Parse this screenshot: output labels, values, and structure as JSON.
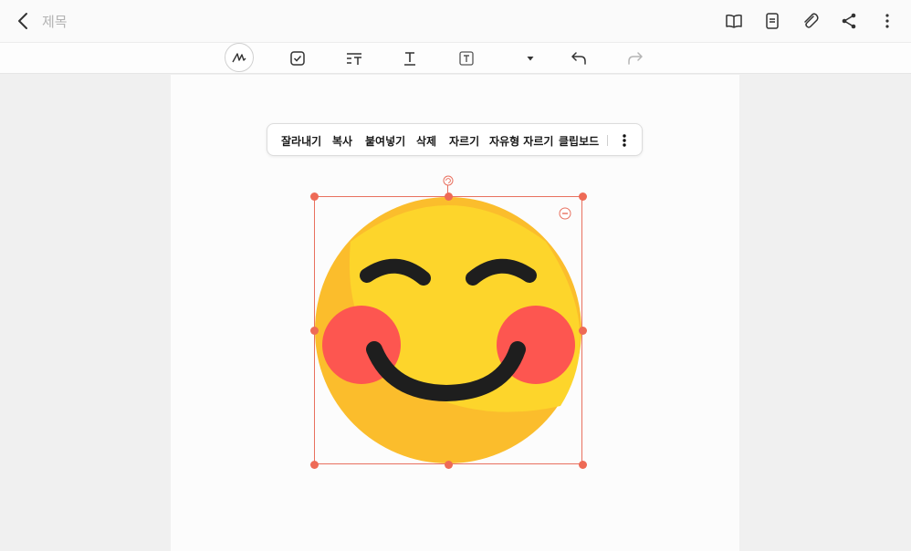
{
  "header": {
    "title": "제목",
    "icons": [
      "back-icon",
      "book-icon",
      "note-list-icon",
      "attach-icon",
      "share-icon",
      "more-vert-icon"
    ]
  },
  "toolbar": {
    "tools": [
      "pen-icon",
      "checkbox-icon",
      "text-style-icon",
      "text-icon",
      "textbox-icon",
      "dropdown-arrow-icon",
      "undo-icon",
      "redo-icon"
    ]
  },
  "context_menu": {
    "items": [
      "잘라내기",
      "복사",
      "붙여넣기",
      "삭제",
      "자르기",
      "자유형 자르기",
      "클립보드"
    ]
  },
  "image": {
    "description_icon": "smiling-face-emoji",
    "colors": {
      "face": "#FDD52B",
      "shade": "#FBBD2C",
      "cheek": "#FD5650",
      "feature": "#1E1E1E",
      "selection": "#E8705F"
    }
  }
}
